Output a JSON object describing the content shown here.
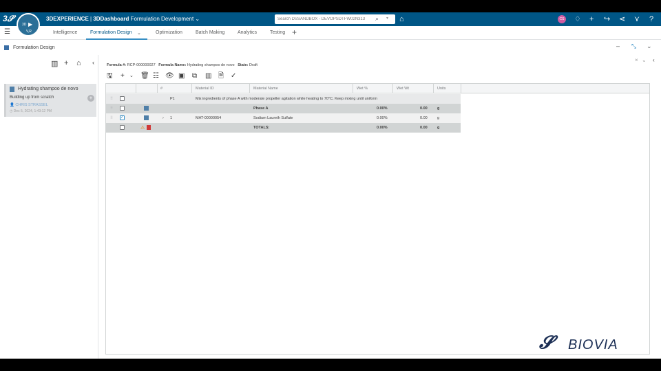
{
  "topbar": {
    "brand": "3DEXPERIENCE",
    "separator": " | ",
    "dashboard": "3DDashboard",
    "app_name": "Formulation Development",
    "search_placeholder": "Search DSSANDBOX - DEVOPSDTFW02N313",
    "avatar_initials": "CS",
    "compass_labels": [
      "3D",
      "V,R"
    ]
  },
  "tabs": [
    {
      "label": "Intelligence"
    },
    {
      "label": "Formulation Design"
    },
    {
      "label": "Optimization"
    },
    {
      "label": "Batch Making"
    },
    {
      "label": "Analytics"
    },
    {
      "label": "Testing"
    }
  ],
  "section": {
    "title": "Formulation Design"
  },
  "card": {
    "title": "Hydrating shampoo de novo",
    "subtitle": "Building up from scratch",
    "user": "CHRIS STRASSEL",
    "date": "Dec 5, 2024, 1:43:12 PM"
  },
  "info": {
    "formula_label": "Formula #:",
    "formula_value": "RCP-000000027",
    "name_label": "Formula Name:",
    "name_value": "Hydrating shampoo de novo",
    "state_label": "State:",
    "state_value": "Draft"
  },
  "grid": {
    "columns": [
      "#",
      "Material ID",
      "Material Name",
      "Wet %",
      "Wet Wt",
      "Units"
    ],
    "rows": [
      {
        "type": "process",
        "num": "P1",
        "text": "Mix ingredients of phase A with moderate propeller agitation while heating to 70°C. Keep mixing until uniform"
      },
      {
        "type": "phase",
        "name": "Phase A",
        "wet_pct": "0.00%",
        "wet_wt": "0.00",
        "units": "g"
      },
      {
        "type": "material",
        "expand": "›",
        "num": "1",
        "material_id": "MAT-00000054",
        "name": "Sodium Laureth Sulfate",
        "wet_pct": "0.00%",
        "wet_wt": "0.00",
        "units": "g"
      },
      {
        "type": "totals",
        "name": "TOTALS:",
        "wet_pct": "0.00%",
        "wet_wt": "0.00",
        "units": "g"
      }
    ]
  },
  "footer": {
    "logo_text": "BIOVIA"
  },
  "colors": {
    "topbar": "#005686",
    "accent": "#368ec4",
    "row_gray": "#d1d4d4",
    "row_light": "#f1f1f1"
  }
}
